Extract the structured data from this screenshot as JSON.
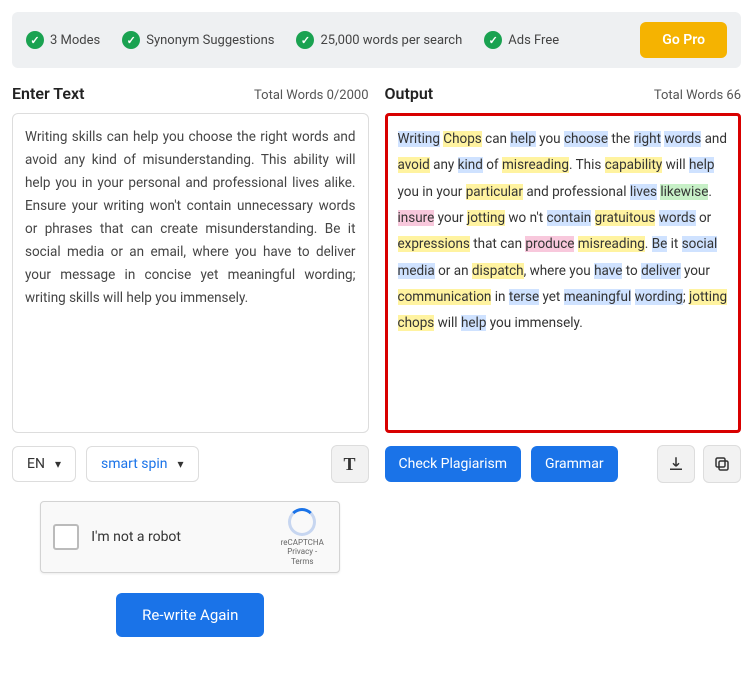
{
  "topbar": {
    "features": [
      "3 Modes",
      "Synonym Suggestions",
      "25,000 words per search",
      "Ads Free"
    ],
    "gopro": "Go Pro"
  },
  "left": {
    "title": "Enter Text",
    "counter": "Total Words 0/2000",
    "text": "Writing skills can help you choose the right words and avoid any kind of misunderstanding. This ability will help you in your personal and professional lives alike. Ensure your writing won't contain unnecessary words or phrases that can create misunderstanding. Be it social media or an email, where you have to deliver your message in concise yet meaningful wording; writing skills will help you immensely.",
    "lang": "EN",
    "mode": "smart spin",
    "typo_icon": "T"
  },
  "right": {
    "title": "Output",
    "counter": "Total Words 66",
    "check_plag": "Check Plagiarism",
    "grammar": "Grammar",
    "tokens": [
      {
        "t": "Writing",
        "c": "b"
      },
      {
        "t": " "
      },
      {
        "t": "Chops",
        "c": "y"
      },
      {
        "t": " can "
      },
      {
        "t": "help",
        "c": "b"
      },
      {
        "t": " you "
      },
      {
        "t": "choose",
        "c": "b"
      },
      {
        "t": " the "
      },
      {
        "t": "right",
        "c": "b"
      },
      {
        "t": " "
      },
      {
        "t": "words",
        "c": "b"
      },
      {
        "t": " and "
      },
      {
        "t": "avoid",
        "c": "y"
      },
      {
        "t": " any "
      },
      {
        "t": "kind",
        "c": "b"
      },
      {
        "t": " of "
      },
      {
        "t": "misreading",
        "c": "y"
      },
      {
        "t": ". This "
      },
      {
        "t": "capability",
        "c": "y"
      },
      {
        "t": " will "
      },
      {
        "t": "help",
        "c": "b"
      },
      {
        "t": " you in your "
      },
      {
        "t": "particular",
        "c": "y"
      },
      {
        "t": " and professional "
      },
      {
        "t": "lives",
        "c": "b"
      },
      {
        "t": " "
      },
      {
        "t": "likewise",
        "c": "g"
      },
      {
        "t": ". "
      },
      {
        "t": "insure",
        "c": "p"
      },
      {
        "t": " your "
      },
      {
        "t": "jotting",
        "c": "y"
      },
      {
        "t": " wo n't "
      },
      {
        "t": "contain",
        "c": "b"
      },
      {
        "t": " "
      },
      {
        "t": "gratuitous",
        "c": "y"
      },
      {
        "t": " "
      },
      {
        "t": "words",
        "c": "b"
      },
      {
        "t": " or "
      },
      {
        "t": "expressions",
        "c": "y"
      },
      {
        "t": " that can "
      },
      {
        "t": "produce",
        "c": "p"
      },
      {
        "t": " "
      },
      {
        "t": "misreading",
        "c": "y"
      },
      {
        "t": ". "
      },
      {
        "t": "Be",
        "c": "b"
      },
      {
        "t": " it "
      },
      {
        "t": "social",
        "c": "b"
      },
      {
        "t": " "
      },
      {
        "t": "media",
        "c": "b"
      },
      {
        "t": " or an "
      },
      {
        "t": "dispatch",
        "c": "y"
      },
      {
        "t": ", where you "
      },
      {
        "t": "have",
        "c": "b"
      },
      {
        "t": " to "
      },
      {
        "t": "deliver",
        "c": "b"
      },
      {
        "t": " your "
      },
      {
        "t": "communication",
        "c": "y"
      },
      {
        "t": " in "
      },
      {
        "t": "terse",
        "c": "b"
      },
      {
        "t": " yet "
      },
      {
        "t": "meaningful",
        "c": "b"
      },
      {
        "t": " "
      },
      {
        "t": "wording",
        "c": "b"
      },
      {
        "t": "; "
      },
      {
        "t": "jotting",
        "c": "y"
      },
      {
        "t": " "
      },
      {
        "t": "chops",
        "c": "y"
      },
      {
        "t": " will "
      },
      {
        "t": "help",
        "c": "b"
      },
      {
        "t": " you immensely."
      }
    ]
  },
  "recaptcha": {
    "label": "I'm not a robot",
    "brand": "reCAPTCHA",
    "legal": "Privacy - Terms"
  },
  "rewrite": "Re-write Again"
}
